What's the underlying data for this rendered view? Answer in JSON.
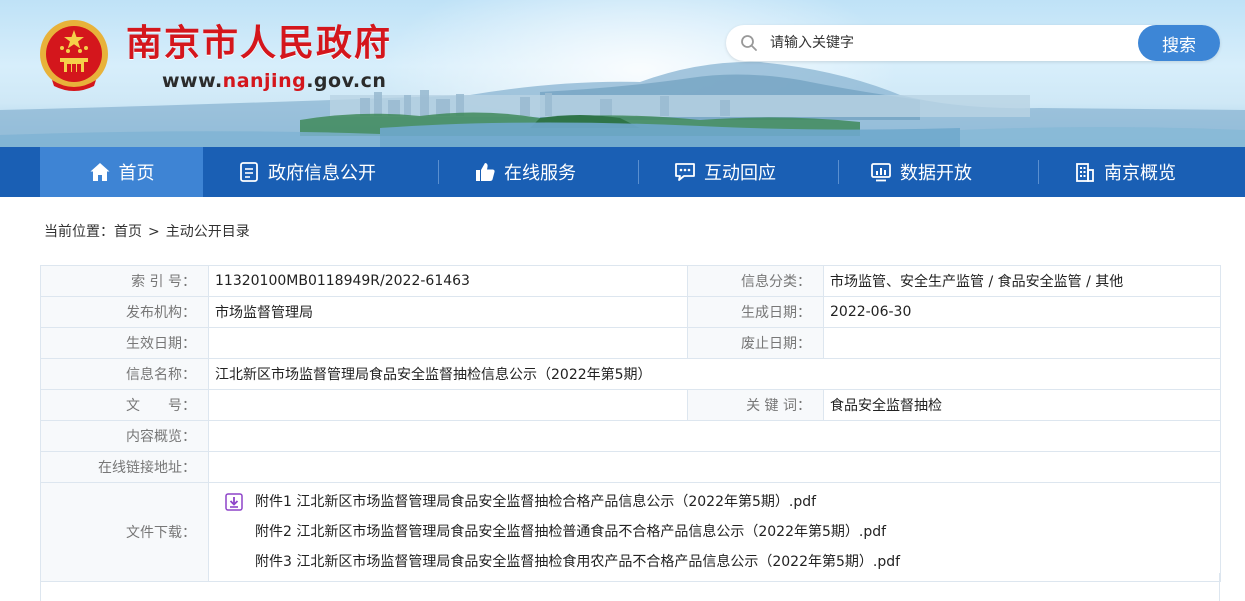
{
  "header": {
    "title": "南京市人民政府",
    "domain_prefix": "www.",
    "domain_highlight": "nanjing",
    "domain_suffix": ".gov.cn",
    "brand_color": "#d4161c"
  },
  "search": {
    "placeholder": "请输入关键字",
    "button_label": "搜索"
  },
  "nav": {
    "items": [
      {
        "label": "首页",
        "icon": "home-icon",
        "active": true
      },
      {
        "label": "政府信息公开",
        "icon": "document-icon"
      },
      {
        "label": "在线服务",
        "icon": "thumb-up-icon"
      },
      {
        "label": "互动回应",
        "icon": "chat-icon"
      },
      {
        "label": "数据开放",
        "icon": "chart-monitor-icon"
      },
      {
        "label": "南京概览",
        "icon": "building-icon"
      }
    ],
    "bar_color": "#1a5fb4",
    "active_color": "#3e84d4"
  },
  "breadcrumb": {
    "prefix": "当前位置：",
    "home": "首页",
    "separator": ">",
    "current": "主动公开目录"
  },
  "info": {
    "index_label": "索 引 号：",
    "index_value": "11320100MB0118949R/2022-61463",
    "category_label": "信息分类：",
    "category_value": "市场监管、安全生产监管 / 食品安全监管 / 其他",
    "publisher_label": "发布机构：",
    "publisher_value": "市场监督管理局",
    "created_label": "生成日期：",
    "created_value": "2022-06-30",
    "effective_label": "生效日期：",
    "effective_value": "",
    "expire_label": "废止日期：",
    "expire_value": "",
    "name_label": "信息名称：",
    "name_value": "江北新区市场监督管理局食品安全监督抽检信息公示（2022年第5期）",
    "doc_label": "文　　号：",
    "doc_value": "",
    "keywords_label": "关 键 词：",
    "keywords_value": "食品安全监督抽检",
    "summary_label": "内容概览：",
    "summary_value": "",
    "link_label": "在线链接地址：",
    "link_value": "",
    "files_label": "文件下载：",
    "files": [
      "附件1 江北新区市场监督管理局食品安全监督抽检合格产品信息公示（2022年第5期）.pdf",
      "附件2 江北新区市场监督管理局食品安全监督抽检普通食品不合格产品信息公示（2022年第5期）.pdf",
      "附件3 江北新区市场监督管理局食品安全监督抽检食用农产品不合格产品信息公示（2022年第5期）.pdf"
    ]
  }
}
